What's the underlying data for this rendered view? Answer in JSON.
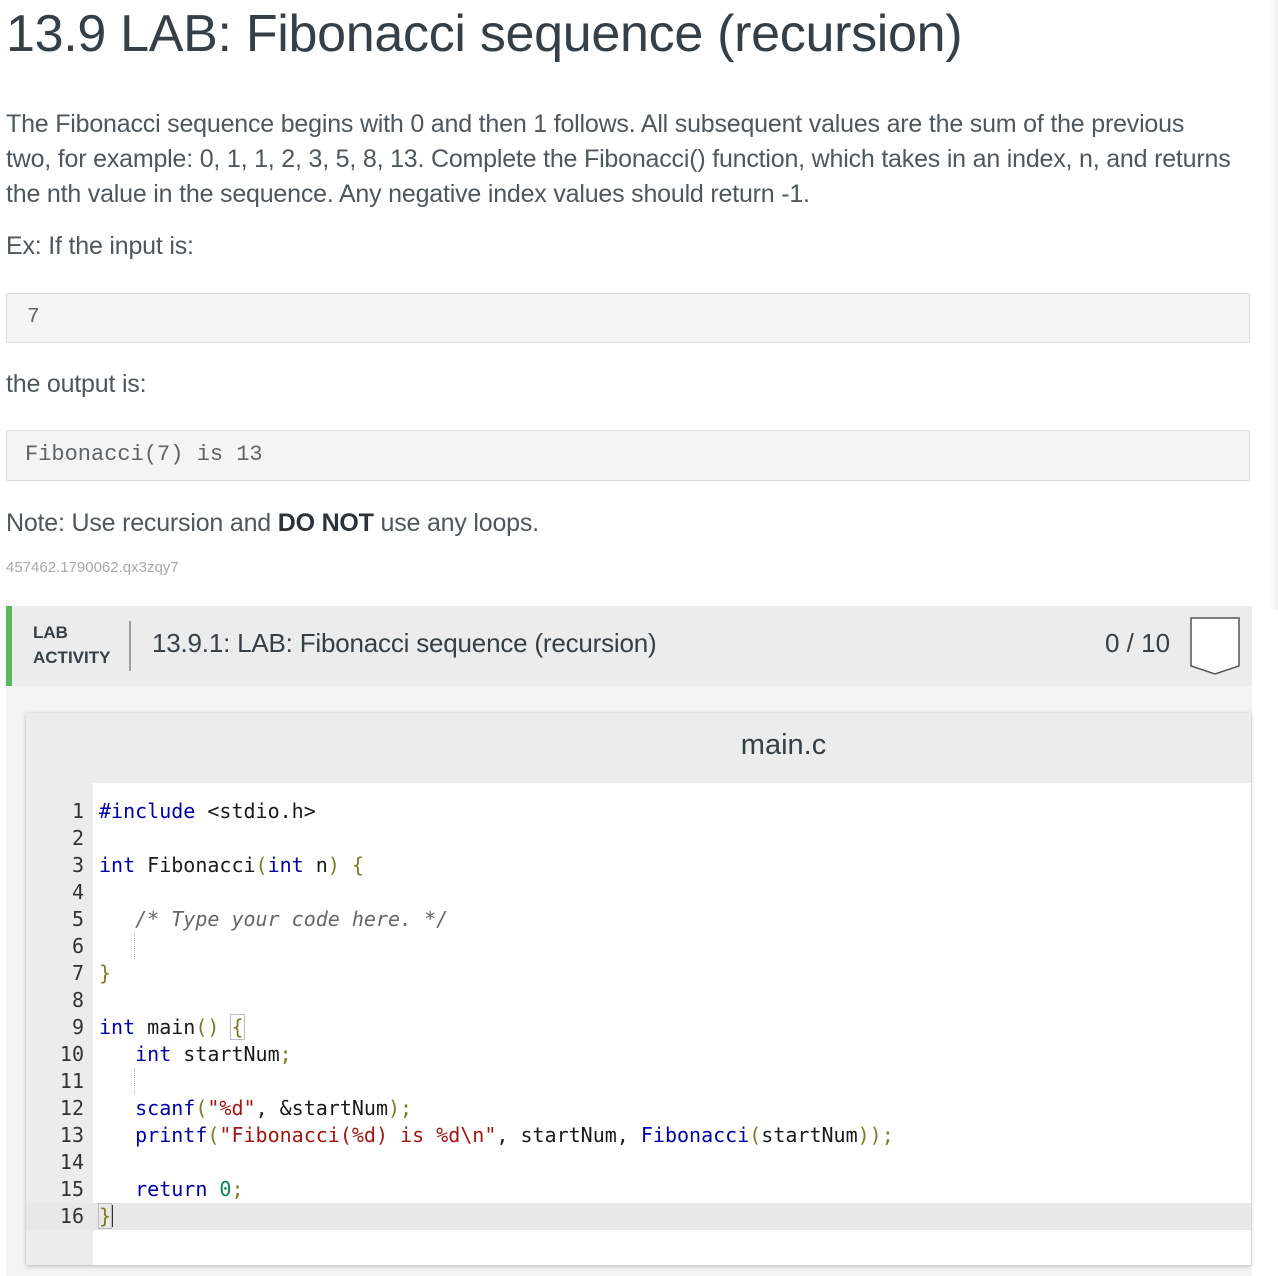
{
  "heading": "13.9 LAB: Fibonacci sequence (recursion)",
  "description": [
    "The Fibonacci sequence begins with 0 and then 1 follows. All subsequent values are the sum of the previous",
    "two, for example: 0, 1, 1, 2, 3, 5, 8, 13. Complete the Fibonacci() function, which takes in an index, n, and returns",
    "the nth value in the sequence. Any negative index values should return -1."
  ],
  "example_input_label": "Ex: If the input is:",
  "example_input": "7",
  "example_output_label": "the output is:",
  "example_output": "Fibonacci(7) is 13",
  "note": {
    "prefix": "Note: Use recursion and ",
    "emphasis": "DO NOT",
    "suffix": " use any loops."
  },
  "activity_id": "457462.1790062.qx3zqy7",
  "lab": {
    "tag_line1": "LAB",
    "tag_line2": "ACTIVITY",
    "title": "13.9.1: LAB: Fibonacci sequence (recursion)",
    "score": "0 / 10"
  },
  "editor": {
    "file_name": "main.c",
    "line_numbers": [
      "1",
      "2",
      "3",
      "4",
      "5",
      "6",
      "7",
      "8",
      "9",
      "10",
      "11",
      "12",
      "13",
      "14",
      "15",
      "16"
    ],
    "lines": [
      "#include <stdio.h>",
      "",
      "int Fibonacci(int n) {",
      "",
      "   /* Type your code here. */",
      "",
      "}",
      "",
      "int main() {",
      "   int startNum;",
      "",
      "   scanf(\"%d\", &startNum);",
      "   printf(\"Fibonacci(%d) is %d\\n\", startNum, Fibonacci(startNum));",
      "",
      "   return 0;",
      "}"
    ]
  },
  "colors": {
    "accent_green": "#5cb85c",
    "keyword": "#0000a8",
    "string": "#a31515",
    "number": "#098658"
  }
}
